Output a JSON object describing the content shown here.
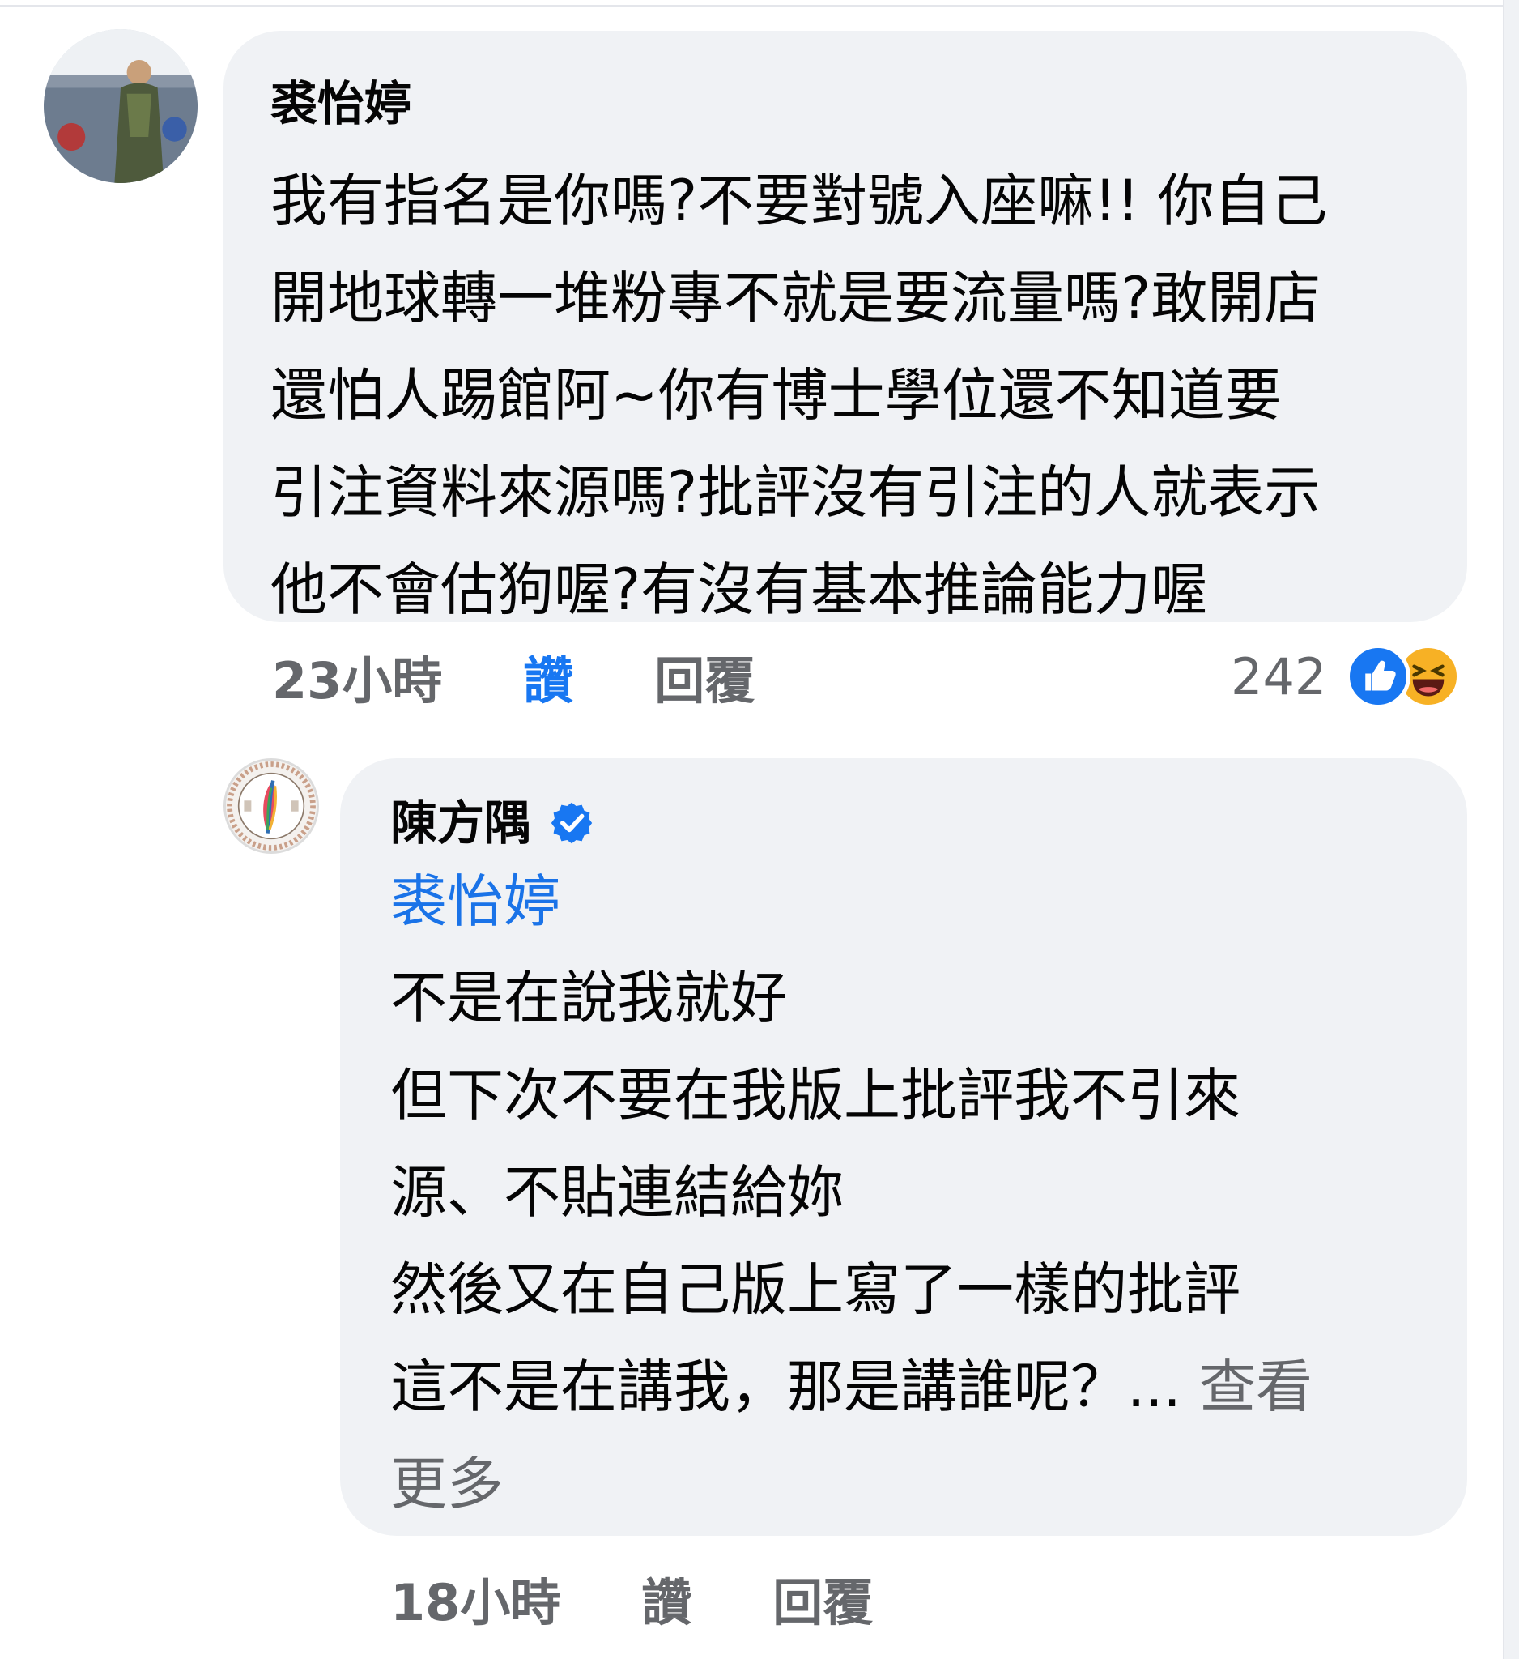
{
  "comment": {
    "author": "裘怡婷",
    "lines": [
      "我有指名是你嗎?不要對號入座嘛!! 你自己",
      "開地球轉一堆粉專不就是要流量嗎?敢開店",
      "還怕人踢館阿~你有博士學位還不知道要",
      "引注資料來源嗎?批評沒有引注的人就表示",
      "他不會估狗喔?有沒有基本推論能力喔"
    ],
    "time": "23小時",
    "like_label": "讚",
    "reply_label": "回覆",
    "reaction_count": "242",
    "reactions": [
      "like-icon",
      "haha-icon"
    ]
  },
  "reply": {
    "author": "陳方隅",
    "verified": true,
    "mention": "裘怡婷",
    "lines": [
      "不是在說我就好",
      "但下次不要在我版上批評我不引來",
      "源、不貼連結給妳",
      "然後又在自己版上寫了一樣的批評",
      "這不是在講我，那是講誰呢？..."
    ],
    "see_more_part1": " 查看",
    "see_more_part2": "更多",
    "time": "18小時",
    "like_label": "讚",
    "reply_label": "回覆"
  },
  "colors": {
    "bubble": "#f0f2f5",
    "link": "#1a73e8",
    "meta": "#65676b",
    "like_blue": "#1877f2"
  }
}
